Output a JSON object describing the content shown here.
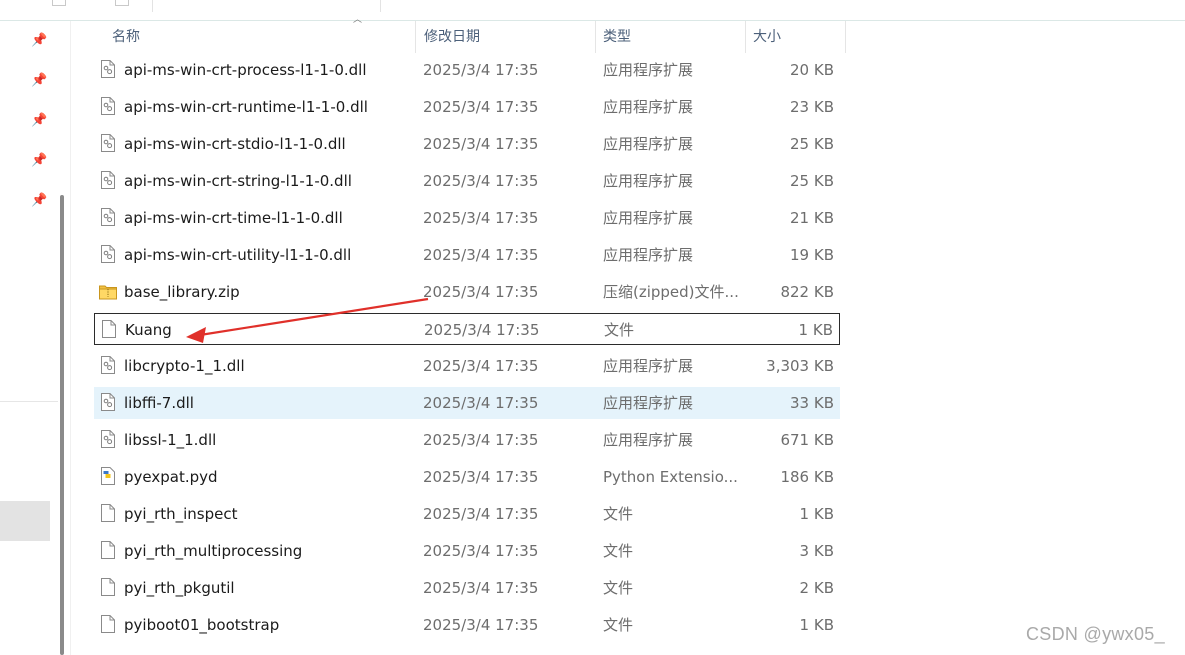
{
  "columns": {
    "name": "名称",
    "modified": "修改日期",
    "type": "类型",
    "size": "大小"
  },
  "files": [
    {
      "name": "api-ms-win-crt-process-l1-1-0.dll",
      "modified": "2025/3/4 17:35",
      "type": "应用程序扩展",
      "size": "20 KB",
      "icon": "dll-file-icon"
    },
    {
      "name": "api-ms-win-crt-runtime-l1-1-0.dll",
      "modified": "2025/3/4 17:35",
      "type": "应用程序扩展",
      "size": "23 KB",
      "icon": "dll-file-icon"
    },
    {
      "name": "api-ms-win-crt-stdio-l1-1-0.dll",
      "modified": "2025/3/4 17:35",
      "type": "应用程序扩展",
      "size": "25 KB",
      "icon": "dll-file-icon"
    },
    {
      "name": "api-ms-win-crt-string-l1-1-0.dll",
      "modified": "2025/3/4 17:35",
      "type": "应用程序扩展",
      "size": "25 KB",
      "icon": "dll-file-icon"
    },
    {
      "name": "api-ms-win-crt-time-l1-1-0.dll",
      "modified": "2025/3/4 17:35",
      "type": "应用程序扩展",
      "size": "21 KB",
      "icon": "dll-file-icon"
    },
    {
      "name": "api-ms-win-crt-utility-l1-1-0.dll",
      "modified": "2025/3/4 17:35",
      "type": "应用程序扩展",
      "size": "19 KB",
      "icon": "dll-file-icon"
    },
    {
      "name": "base_library.zip",
      "modified": "2025/3/4 17:35",
      "type": "压缩(zipped)文件...",
      "size": "822 KB",
      "icon": "zip-folder-icon"
    },
    {
      "name": "Kuang",
      "modified": "2025/3/4 17:35",
      "type": "文件",
      "size": "1 KB",
      "icon": "blank-file-icon"
    },
    {
      "name": "libcrypto-1_1.dll",
      "modified": "2025/3/4 17:35",
      "type": "应用程序扩展",
      "size": "3,303 KB",
      "icon": "dll-file-icon"
    },
    {
      "name": "libffi-7.dll",
      "modified": "2025/3/4 17:35",
      "type": "应用程序扩展",
      "size": "33 KB",
      "icon": "dll-file-icon"
    },
    {
      "name": "libssl-1_1.dll",
      "modified": "2025/3/4 17:35",
      "type": "应用程序扩展",
      "size": "671 KB",
      "icon": "dll-file-icon"
    },
    {
      "name": "pyexpat.pyd",
      "modified": "2025/3/4 17:35",
      "type": "Python Extensio...",
      "size": "186 KB",
      "icon": "python-file-icon"
    },
    {
      "name": "pyi_rth_inspect",
      "modified": "2025/3/4 17:35",
      "type": "文件",
      "size": "1 KB",
      "icon": "blank-file-icon"
    },
    {
      "name": "pyi_rth_multiprocessing",
      "modified": "2025/3/4 17:35",
      "type": "文件",
      "size": "3 KB",
      "icon": "blank-file-icon"
    },
    {
      "name": "pyi_rth_pkgutil",
      "modified": "2025/3/4 17:35",
      "type": "文件",
      "size": "2 KB",
      "icon": "blank-file-icon"
    },
    {
      "name": "pyiboot01_bootstrap",
      "modified": "2025/3/4 17:35",
      "type": "文件",
      "size": "1 KB",
      "icon": "blank-file-icon"
    }
  ],
  "focused_row": 7,
  "hover_row": 9,
  "annotation_arrow_color": "#e0302a",
  "watermark": "CSDN @ywx05_"
}
